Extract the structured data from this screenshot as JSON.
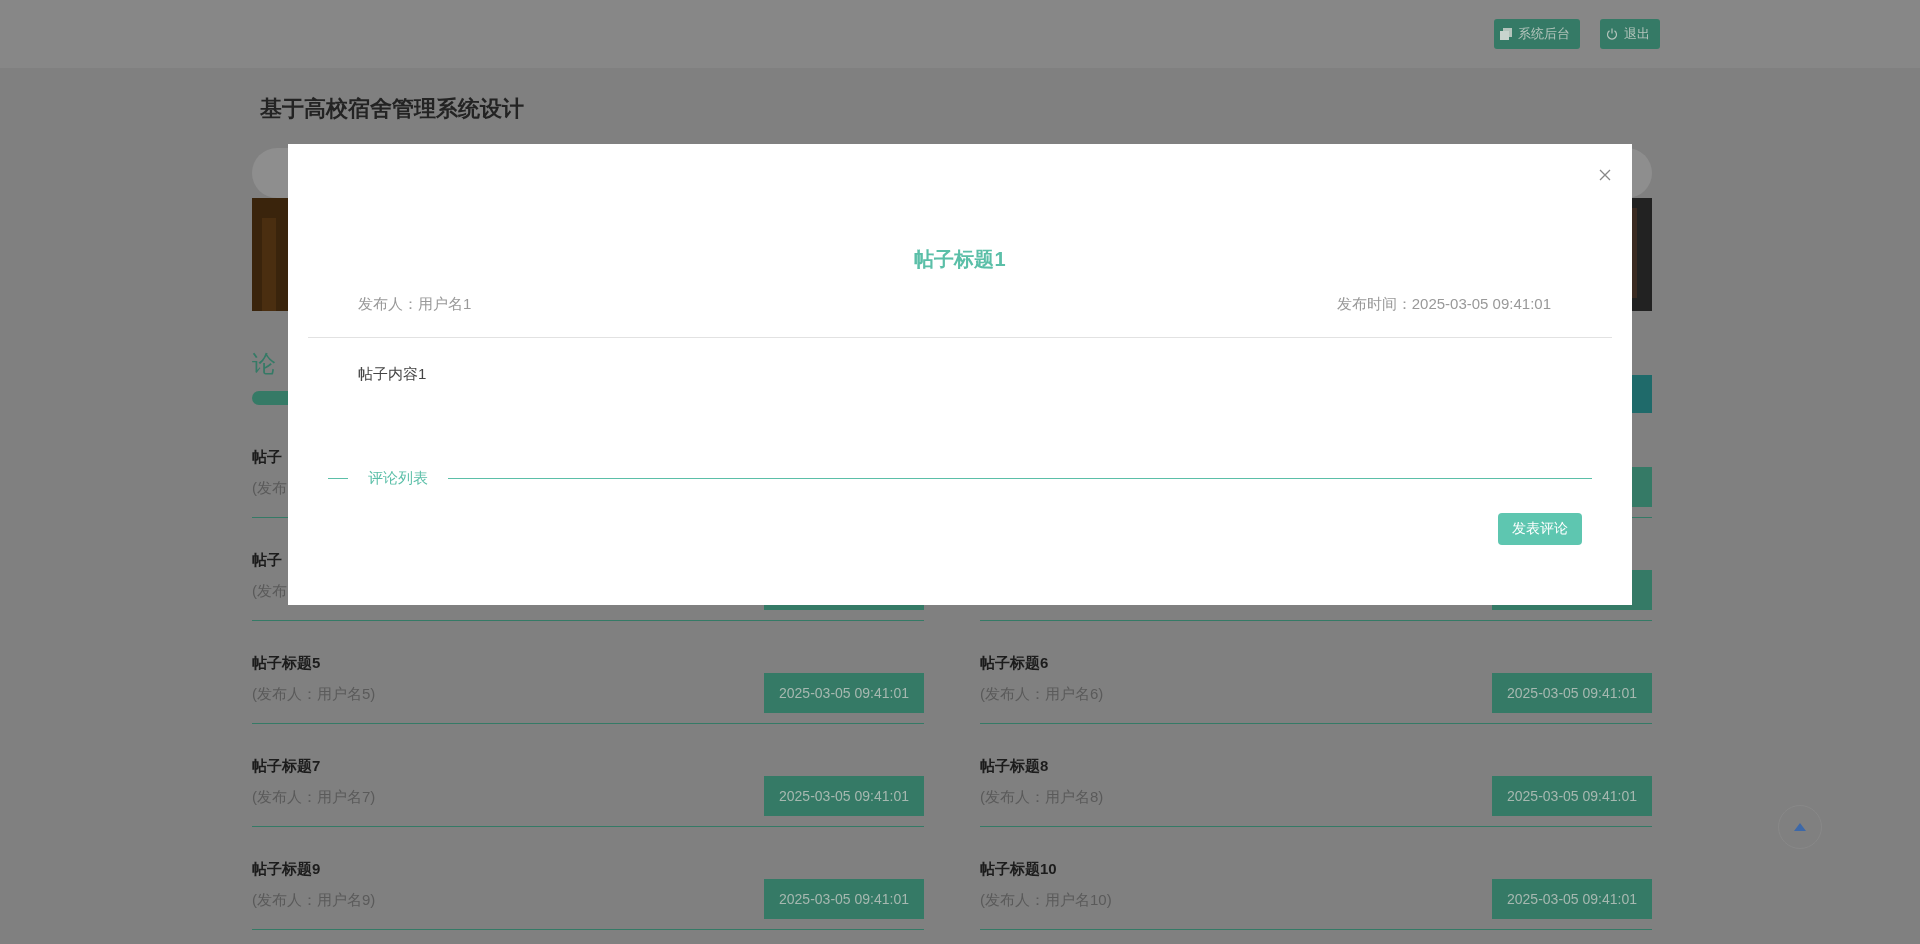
{
  "header": {
    "buttons": [
      {
        "label": "系统后台"
      },
      {
        "label": "退出"
      }
    ]
  },
  "site_title": "基于高校宿舍管理系统设计",
  "section": {
    "heading": "论"
  },
  "columns": [
    {
      "posts": [
        {
          "kind": "cut",
          "title": "帖子",
          "author": "(发布"
        },
        {
          "kind": "covered",
          "title": "帖子",
          "author": "(发布"
        },
        {
          "kind": "post",
          "title": "帖子标题5",
          "author": "(发布人：用户名5)",
          "time": "2025-03-05 09:41:01"
        },
        {
          "kind": "post",
          "title": "帖子标题7",
          "author": "(发布人：用户名7)",
          "time": "2025-03-05 09:41:01"
        },
        {
          "kind": "post",
          "title": "帖子标题9",
          "author": "(发布人：用户名9)",
          "time": "2025-03-05 09:41:01"
        }
      ]
    },
    {
      "posts": [
        {
          "kind": "covered"
        },
        {
          "kind": "covered"
        },
        {
          "kind": "post",
          "title": "帖子标题6",
          "author": "(发布人：用户名6)",
          "time": "2025-03-05 09:41:01"
        },
        {
          "kind": "post",
          "title": "帖子标题8",
          "author": "(发布人：用户名8)",
          "time": "2025-03-05 09:41:01"
        },
        {
          "kind": "post",
          "title": "帖子标题10",
          "author": "(发布人：用户名10)",
          "time": "2025-03-05 09:41:01"
        }
      ]
    }
  ],
  "modal": {
    "title": "帖子标题1",
    "author": "发布人：用户名1",
    "time": "发布时间：2025-03-05 09:41:01",
    "content": "帖子内容1",
    "comments_heading": "评论列表",
    "comment_button": "发表评论"
  }
}
